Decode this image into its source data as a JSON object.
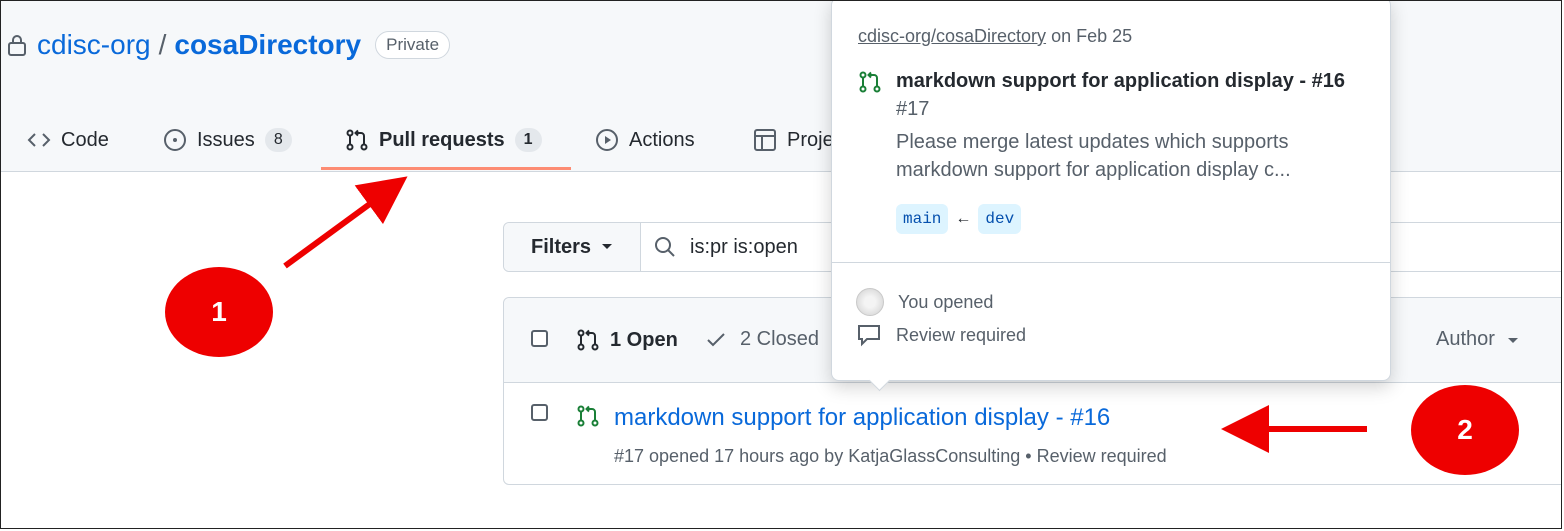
{
  "repo": {
    "owner": "cdisc-org",
    "separator": "/",
    "name": "cosaDirectory",
    "visibility": "Private"
  },
  "tabs": [
    {
      "label": "Code",
      "icon": "code-icon"
    },
    {
      "label": "Issues",
      "count": "8",
      "icon": "issue-icon"
    },
    {
      "label": "Pull requests",
      "count": "1",
      "icon": "pull-request-icon",
      "active": true
    },
    {
      "label": "Actions",
      "icon": "play-icon"
    },
    {
      "label": "Proje",
      "icon": "table-icon"
    }
  ],
  "filter": {
    "button_label": "Filters",
    "query": "is:pr is:open"
  },
  "list": {
    "open_label": "1 Open",
    "closed_label": "2 Closed",
    "author_label": "Author",
    "rows": [
      {
        "title": "markdown support for application display - #16",
        "meta": "#17 opened 17 hours ago by KatjaGlassConsulting • Review required"
      }
    ]
  },
  "popup": {
    "repo_link": "cdisc-org/cosaDirectory",
    "date_text": " on Feb 25",
    "title": "markdown support for application display - #16",
    "number": "#17",
    "description": "Please merge latest updates which supports markdown support for application display c...",
    "base_branch": "main",
    "arrow": "←",
    "head_branch": "dev",
    "opened_text": "You opened",
    "review_text": "Review required"
  },
  "callouts": {
    "one": "1",
    "two": "2"
  },
  "colors": {
    "accent": "#0969da",
    "underline": "#fd8c73",
    "callout": "#ee0000",
    "open_green": "#1a7f37"
  }
}
